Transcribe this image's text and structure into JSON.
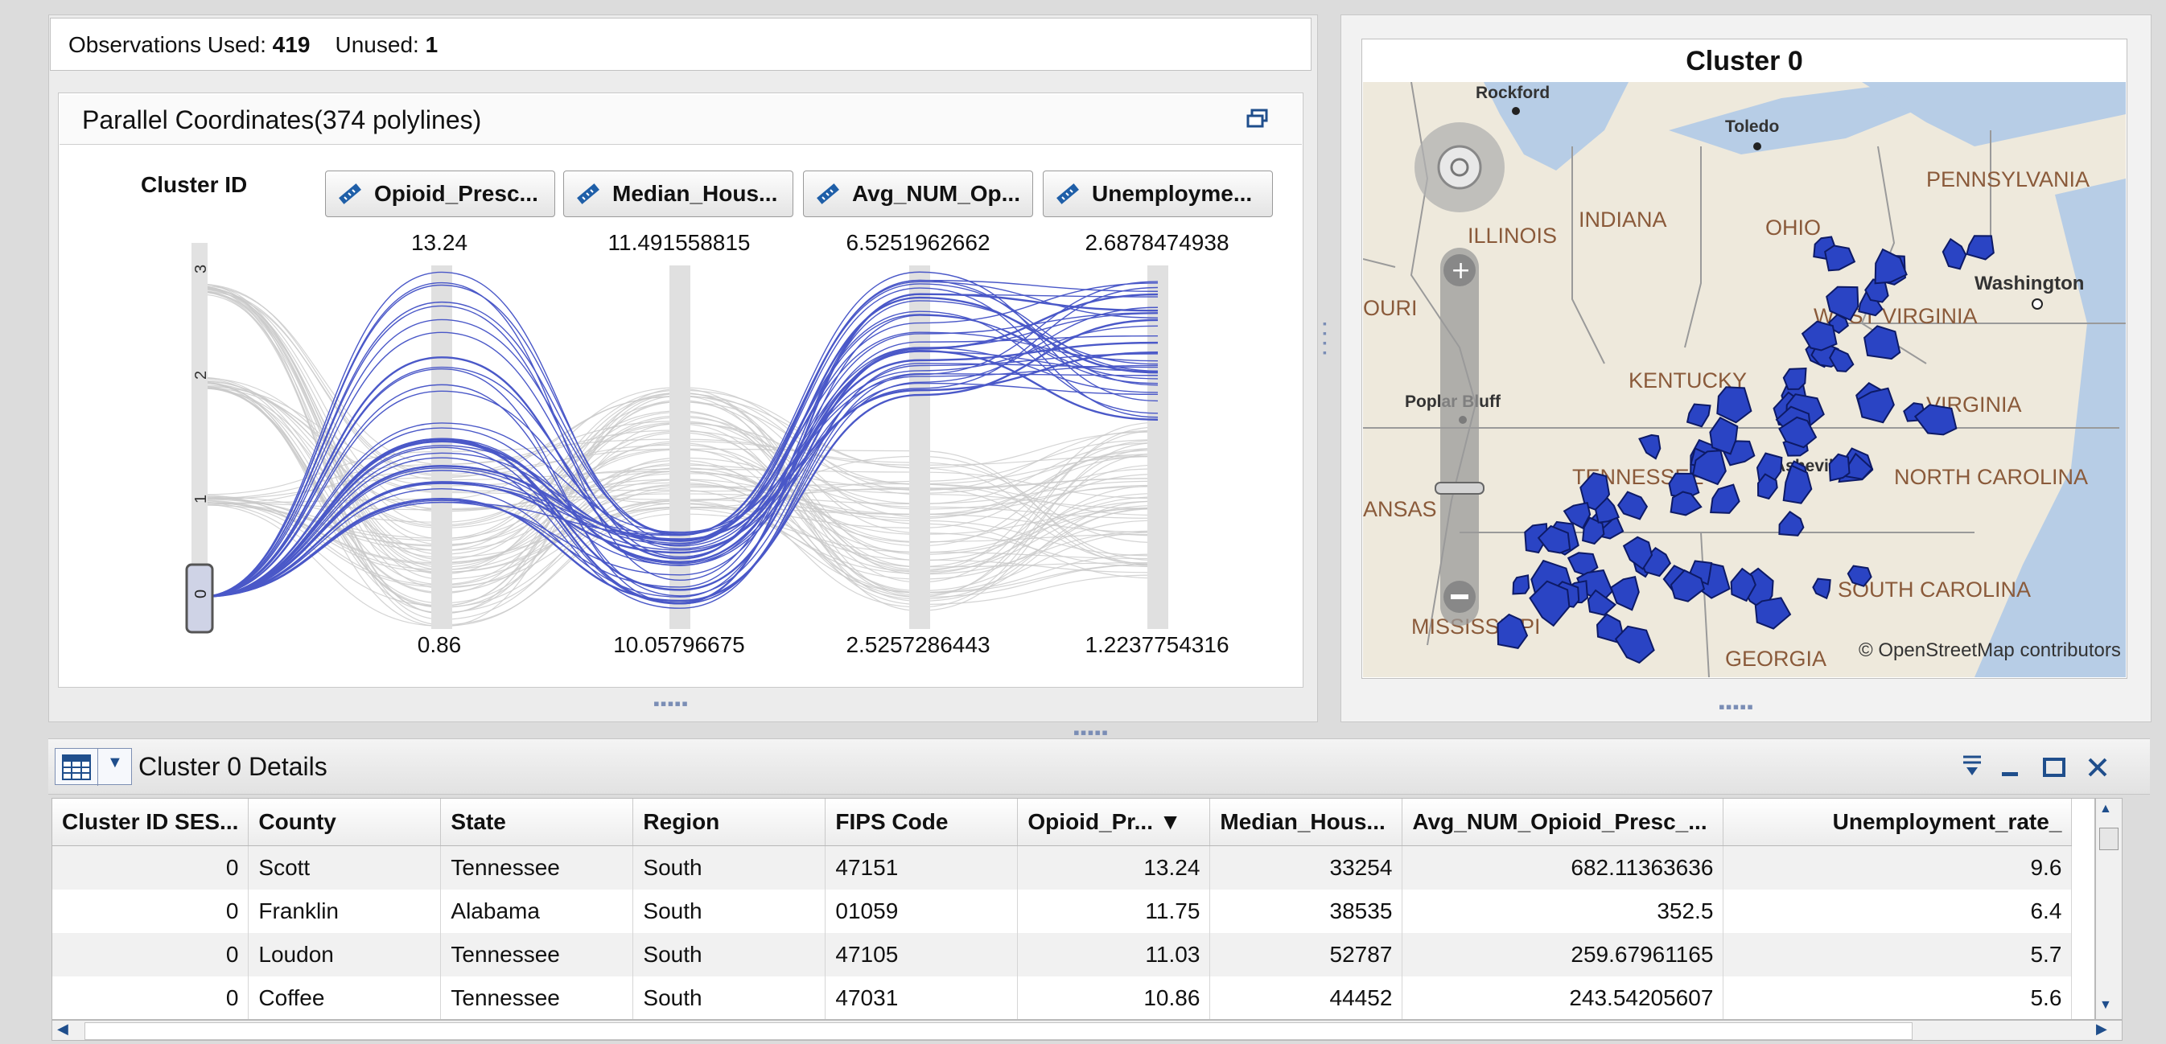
{
  "observations": {
    "used_label": "Observations Used:",
    "used_value": "419",
    "unused_label": "Unused:",
    "unused_value": "1"
  },
  "parallel": {
    "title": "Parallel Coordinates(374 polylines)",
    "cluster_axis_label": "Cluster ID",
    "cluster_ticks": [
      "3",
      "2",
      "1",
      "0"
    ],
    "selected_cluster": "0",
    "variables": [
      {
        "label": "Opioid_Presc...",
        "max": "13.24",
        "min": "0.86"
      },
      {
        "label": "Median_Hous...",
        "max": "11.491558815",
        "min": "10.05796675"
      },
      {
        "label": "Avg_NUM_Op...",
        "max": "6.5251962662",
        "min": "2.5257286443"
      },
      {
        "label": "Unemployme...",
        "max": "2.6878474938",
        "min": "1.2237754316"
      }
    ],
    "polyline_count": 374,
    "highlight_color": "#4a58c8"
  },
  "map": {
    "title": "Cluster 0",
    "attribution": "© OpenStreetMap contributors",
    "labels": [
      "Rockford",
      "Toledo",
      "PENNSYLVANIA",
      "INDIANA",
      "OHIO",
      "ILLINOIS",
      "Washington",
      "OURI",
      "WEST VIRGINIA",
      "KENTUCKY",
      "Poplar Bluff",
      "VIRGINIA",
      "TENNESSEE",
      "Asheville",
      "NORTH CAROLINA",
      "ANSAS",
      "SOUTH CAROLINA",
      "MISSISSIPPI",
      "GEORGIA"
    ],
    "fill_color": "#2a44c4"
  },
  "details": {
    "title": "Cluster 0 Details",
    "columns": [
      "Cluster ID SES...",
      "County",
      "State",
      "Region",
      "FIPS Code",
      "Opioid_Pr... ▼",
      "Median_Hous...",
      "Avg_NUM_Opioid_Presc_...",
      "Unemployment_rate_"
    ],
    "rows": [
      [
        "0",
        "Scott",
        "Tennessee",
        "South",
        "47151",
        "13.24",
        "33254",
        "682.11363636",
        "9.6"
      ],
      [
        "0",
        "Franklin",
        "Alabama",
        "South",
        "01059",
        "11.75",
        "38535",
        "352.5",
        "6.4"
      ],
      [
        "0",
        "Loudon",
        "Tennessee",
        "South",
        "47105",
        "11.03",
        "52787",
        "259.67961165",
        "5.7"
      ],
      [
        "0",
        "Coffee",
        "Tennessee",
        "South",
        "47031",
        "10.86",
        "44452",
        "243.54205607",
        "5.6"
      ]
    ]
  },
  "colors": {
    "accent": "#4a58c8",
    "toolbar_icon": "#1f4e8c"
  }
}
